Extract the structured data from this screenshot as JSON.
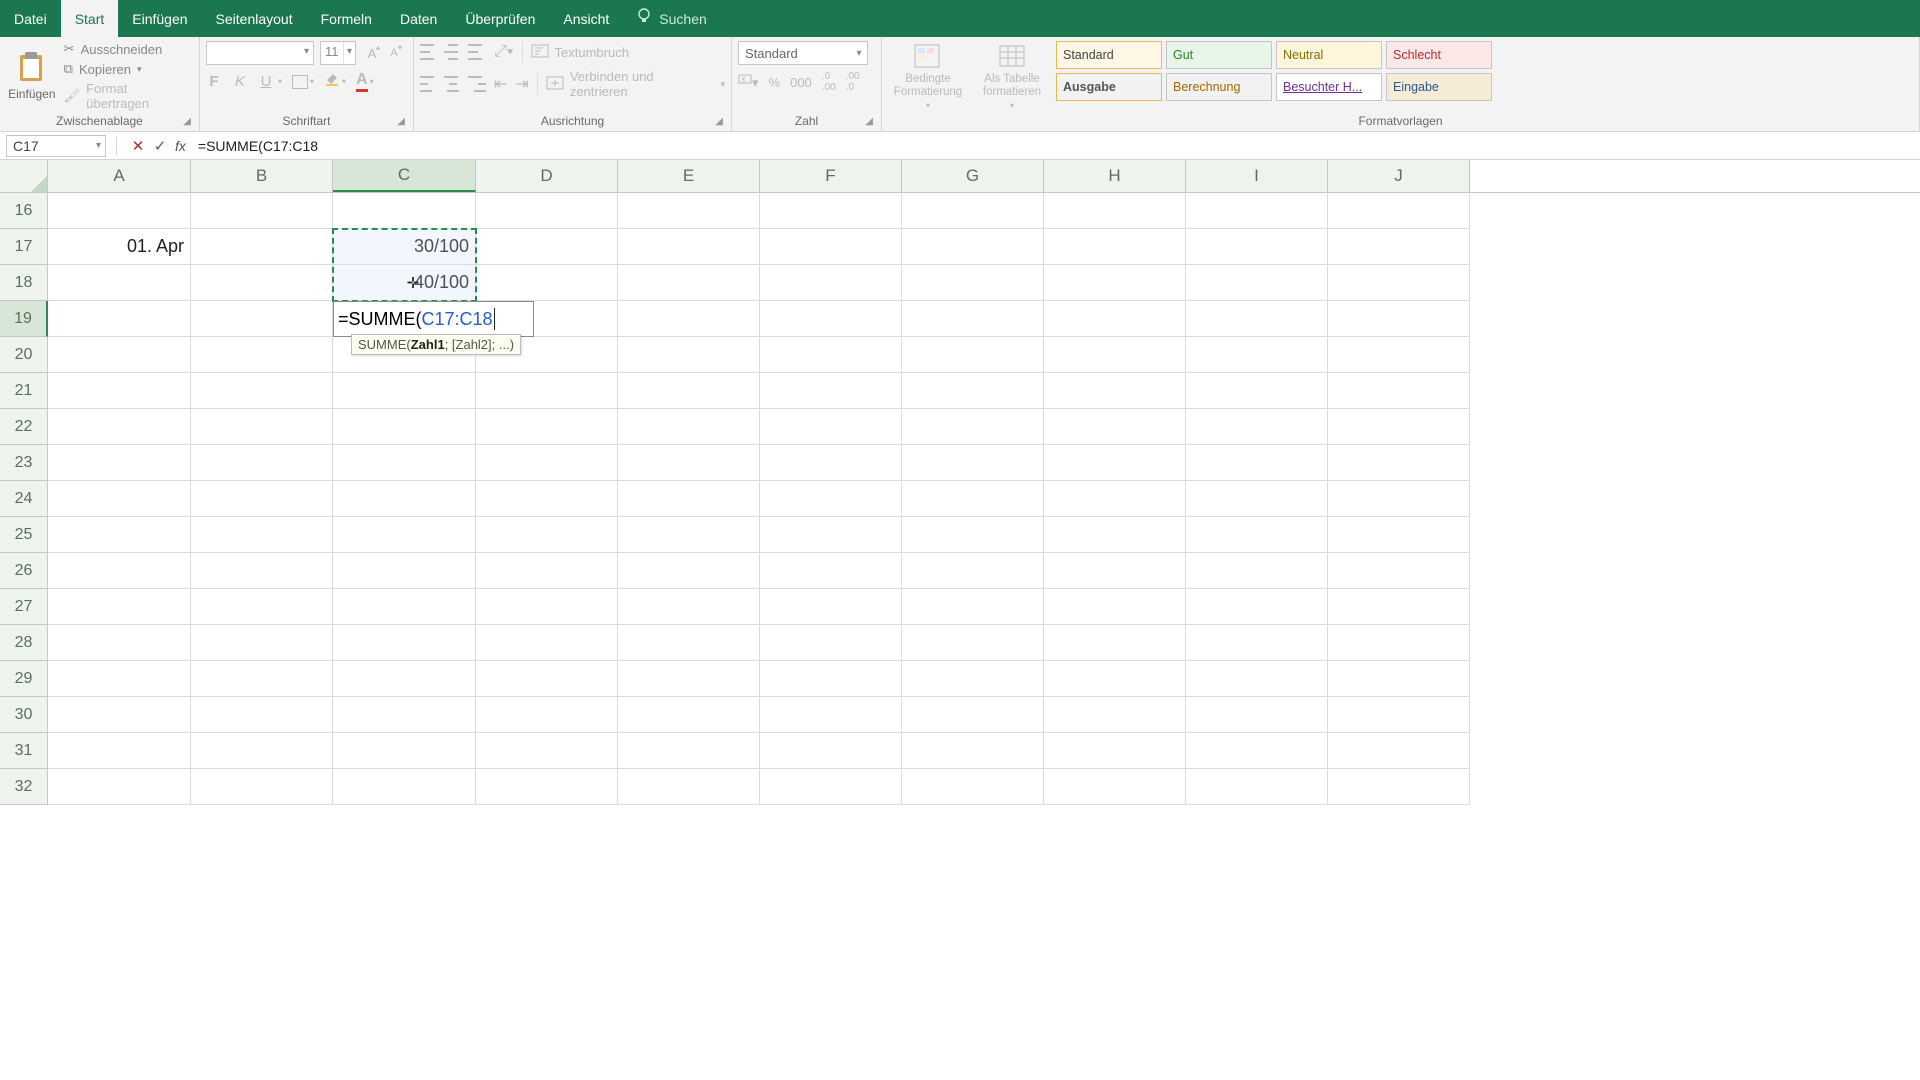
{
  "tabs": {
    "datei": "Datei",
    "start": "Start",
    "einfugen": "Einfügen",
    "seitenlayout": "Seitenlayout",
    "formeln": "Formeln",
    "daten": "Daten",
    "uberprufen": "Überprüfen",
    "ansicht": "Ansicht",
    "suchen": "Suchen"
  },
  "ribbon": {
    "clipboard": {
      "paste": "Einfügen",
      "cut": "Ausschneiden",
      "copy": "Kopieren",
      "format": "Format übertragen",
      "group": "Zwischenablage"
    },
    "font": {
      "size": "11",
      "group": "Schriftart",
      "bold": "F",
      "italic": "K",
      "underline": "U"
    },
    "align": {
      "wrap": "Textumbruch",
      "merge": "Verbinden und zentrieren",
      "group": "Ausrichtung"
    },
    "number": {
      "format": "Standard",
      "group": "Zahl",
      "pct": "%",
      "thou": "000"
    },
    "styles": {
      "cond": "Bedingte Formatierung",
      "table": "Als Tabelle formatieren",
      "group": "Formatvorlagen",
      "standard": "Standard",
      "gut": "Gut",
      "neutral": "Neutral",
      "schlecht": "Schlecht",
      "ausgabe": "Ausgabe",
      "berechnung": "Berechnung",
      "besucht": "Besuchter H...",
      "eingabe": "Eingabe"
    }
  },
  "namebox": "C17",
  "formula": "=SUMME(C17:C18",
  "formula_prefix": "=SUMME(",
  "formula_ref": "C17:C18",
  "cols": [
    "A",
    "B",
    "C",
    "D",
    "E",
    "F",
    "G",
    "H",
    "I",
    "J"
  ],
  "first_row": 16,
  "row_count": 17,
  "cells": {
    "A17": "01. Apr",
    "C17": "30/100",
    "C18": "40/100"
  },
  "tooltip": {
    "fn": "SUMME(",
    "arg1": "Zahl1",
    "rest": "; [Zahl2]; ...)"
  }
}
